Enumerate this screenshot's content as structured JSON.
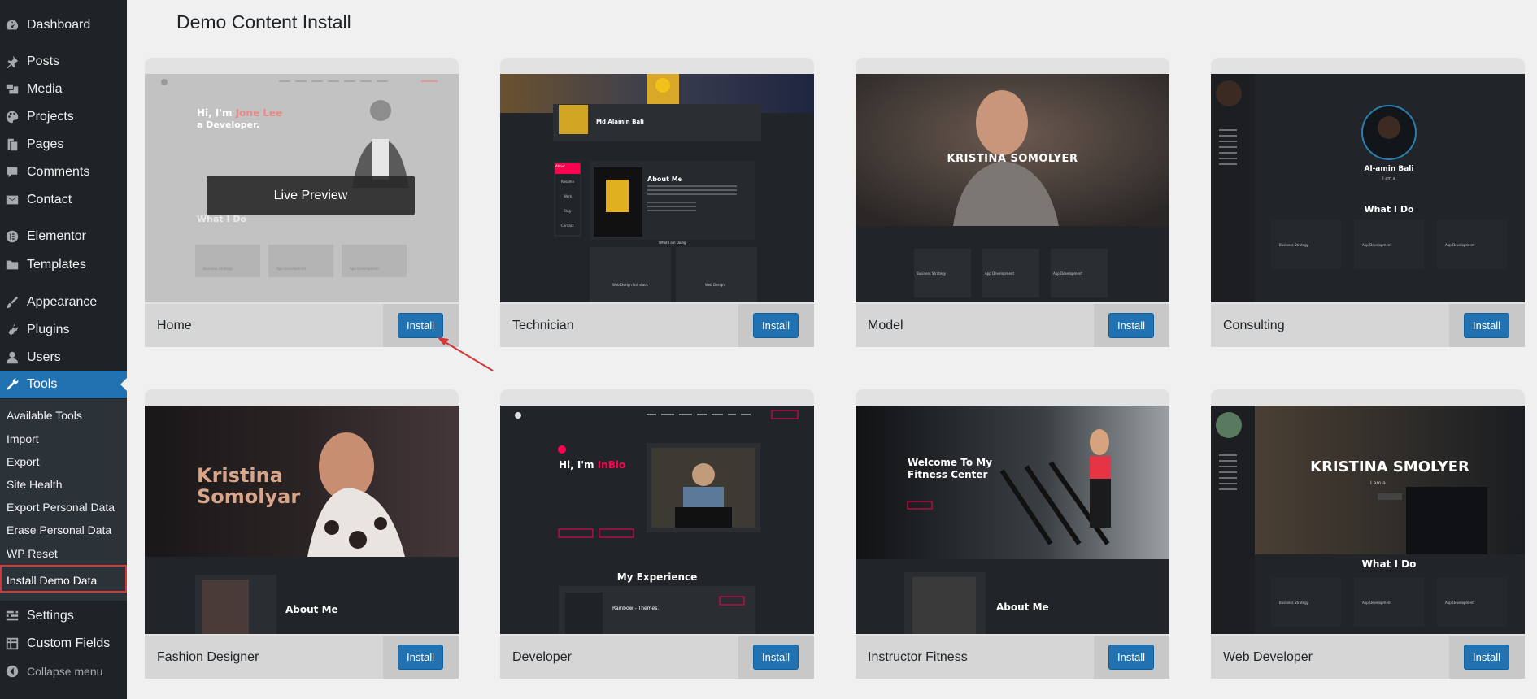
{
  "sidebar": {
    "items": [
      {
        "label": "Dashboard",
        "icon": "dashboard-icon"
      },
      {
        "label": "Posts",
        "icon": "pin-icon"
      },
      {
        "label": "Media",
        "icon": "media-icon"
      },
      {
        "label": "Projects",
        "icon": "palette-icon"
      },
      {
        "label": "Pages",
        "icon": "pages-icon"
      },
      {
        "label": "Comments",
        "icon": "comment-icon"
      },
      {
        "label": "Contact",
        "icon": "mail-icon"
      },
      {
        "label": "Elementor",
        "icon": "elementor-icon"
      },
      {
        "label": "Templates",
        "icon": "folder-icon"
      },
      {
        "label": "Appearance",
        "icon": "brush-icon"
      },
      {
        "label": "Plugins",
        "icon": "plugin-icon"
      },
      {
        "label": "Users",
        "icon": "user-icon"
      },
      {
        "label": "Tools",
        "icon": "wrench-icon"
      },
      {
        "label": "Settings",
        "icon": "settings-icon"
      },
      {
        "label": "Custom Fields",
        "icon": "grid-icon"
      },
      {
        "label": "Collapse menu",
        "icon": "collapse-icon"
      }
    ],
    "submenu": [
      "Available Tools",
      "Import",
      "Export",
      "Site Health",
      "Export Personal Data",
      "Erase Personal Data",
      "WP Reset",
      "Install Demo Data"
    ]
  },
  "page": {
    "title": "Demo Content Install"
  },
  "cards": [
    {
      "name": "Home",
      "button": "Install",
      "overlay": "Live Preview",
      "hero1": "Hi, I'm ",
      "hero_name": "Jone Lee",
      "hero2": "a Developer.",
      "section": "What I Do",
      "services": [
        "Business Strategy",
        "App Development",
        "App Development"
      ]
    },
    {
      "name": "Technician",
      "button": "Install",
      "person": "Md Alamin Bali",
      "section": "About Me",
      "menu": [
        "About",
        "Resume",
        "Work",
        "Blog",
        "Contact"
      ],
      "sub": "What I am Doing",
      "services": [
        "Web Design Full stack",
        "Web Design"
      ]
    },
    {
      "name": "Model",
      "button": "Install",
      "heading": "KRISTINA SOMOLYER",
      "services": [
        "Business Strategy",
        "App Development",
        "App Development"
      ]
    },
    {
      "name": "Consulting",
      "button": "Install",
      "person": "Al-amin Bali",
      "role": "I am a",
      "section": "What I Do",
      "services": [
        "Business Strategy",
        "App Development",
        "App Development"
      ]
    },
    {
      "name": "Fashion Designer",
      "button": "Install",
      "heading1": "Kristina",
      "heading2": "Somolyar",
      "section": "About Me"
    },
    {
      "name": "Developer",
      "button": "Install",
      "hero1": "Hi, I'm ",
      "hero_name": "InBio",
      "section": "My Experience",
      "item": "Rainbow - Themes."
    },
    {
      "name": "Instructor Fitness",
      "button": "Install",
      "heading1": "Welcome To My",
      "heading2": "Fitness Center",
      "section": "About Me"
    },
    {
      "name": "Web Developer",
      "button": "Install",
      "heading": "KRISTINA SMOLYER",
      "role": "I am a",
      "section": "What I Do",
      "services": [
        "Business Strategy",
        "App Development",
        "App Development"
      ]
    }
  ],
  "colors": {
    "accent": "#2271b1",
    "sidebar": "#1d2327",
    "highlight": "#ff014f",
    "annotation": "#d63638"
  }
}
